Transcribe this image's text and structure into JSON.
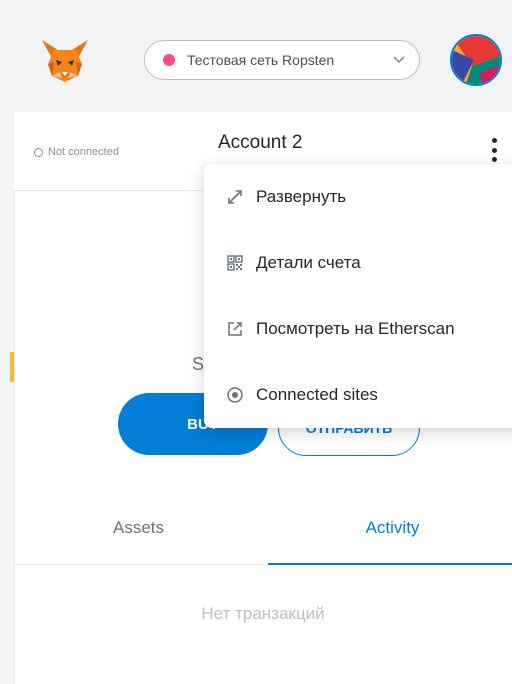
{
  "header": {
    "network_label": "Тестовая сеть Ropsten",
    "network_dot_color": "#ff4a8d",
    "fox_icon": "metamask-fox-icon",
    "avatar_icon": "account-identicon"
  },
  "account": {
    "status": "Not connected",
    "name": "Account 2"
  },
  "menu": {
    "items": [
      {
        "icon": "expand-icon",
        "label": "Развернуть"
      },
      {
        "icon": "qr-code-icon",
        "label": "Детали счета"
      },
      {
        "icon": "external-link-icon",
        "label": "Посмотреть на Etherscan"
      },
      {
        "icon": "connected-sites-icon",
        "label": "Connected sites"
      }
    ]
  },
  "main": {
    "balance_partial": "S",
    "buy_label": "BUY",
    "send_label": "ОТПРАВИТЬ"
  },
  "tabs": {
    "assets": "Assets",
    "activity": "Activity",
    "active": "Activity"
  },
  "activity": {
    "empty_message": "Нет транзакций"
  },
  "colors": {
    "accent": "#037dd6",
    "header_bg": "#f2f3f5"
  }
}
